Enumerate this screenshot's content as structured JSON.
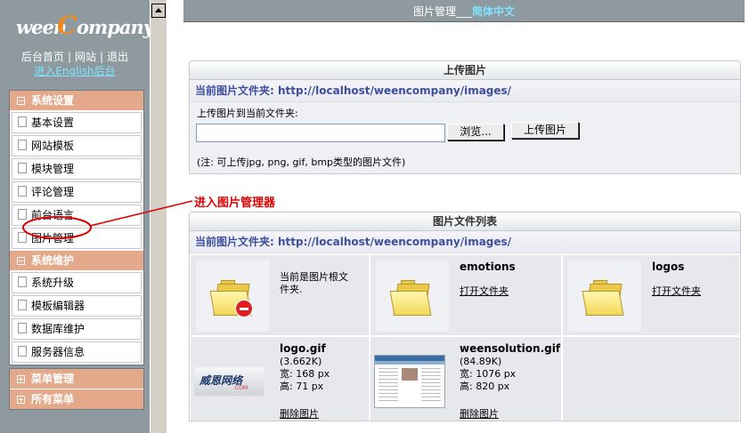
{
  "brand": {
    "logo_part1": "ween",
    "logo_part2": "C",
    "logo_part3": "ompany"
  },
  "nav": {
    "home": "后台首页",
    "site": "网站",
    "logout": "退出",
    "sep": "|",
    "english": "进入English后台"
  },
  "menu_system": {
    "title": "系统设置",
    "items": [
      "基本设置",
      "网站模板",
      "模块管理",
      "评论管理",
      "前台语言",
      "图片管理"
    ]
  },
  "menu_maint": {
    "title": "系统维护",
    "items": [
      "系统升级",
      "模板编辑器",
      "数据库维护",
      "服务器信息"
    ]
  },
  "menu_extra": {
    "menu_manage": "菜单管理",
    "all_menus": "所有菜单"
  },
  "header": {
    "title": "图片管理",
    "underscores": "___",
    "language": "简体中文"
  },
  "upload": {
    "title": "上传图片",
    "path_label": "当前图片文件夹: http://localhost/weencompany/images/",
    "field_label": "上传图片到当前文件夹:",
    "file_value": "",
    "browse_label": "浏览...",
    "submit_label": "上传图片",
    "note": "(注: 可上传jpg, png, gif, bmp类型的图片文件)"
  },
  "callout": "进入图片管理器",
  "filelist": {
    "title": "图片文件列表",
    "path_label": "当前图片文件夹: http://localhost/weencompany/images/",
    "root_note_1": "当前是图片根文",
    "root_note_2": "件夹.",
    "folders": [
      {
        "name": "emotions",
        "action": "打开文件夹"
      },
      {
        "name": "logos",
        "action": "打开文件夹"
      }
    ],
    "images": [
      {
        "name": "logo.gif",
        "size": "(3.662K)",
        "width": "宽: 168 px",
        "height": "高: 71 px",
        "action": "删除图片"
      },
      {
        "name": "weensolution.gif",
        "size": "(84.89K)",
        "width": "宽: 1076 px",
        "height": "高: 820 px",
        "action": "删除图片"
      }
    ],
    "logo_thumb_text": "威恩网络",
    "logo_thumb_sub": ".COM"
  },
  "colors": {
    "frame_gray": "#8f9aa0",
    "menu_head": "#e4a98a",
    "path_blue": "#3f4fa0",
    "callout_red": "#e00000",
    "link_cyan": "#7fe3ff"
  }
}
